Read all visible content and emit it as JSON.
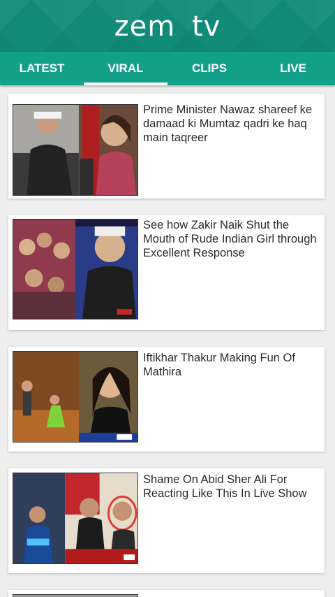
{
  "app": {
    "logo_text": "zem tv"
  },
  "tabs": [
    {
      "label": "LATEST",
      "active": false
    },
    {
      "label": "VIRAL",
      "active": true
    },
    {
      "label": "CLIPS",
      "active": false
    },
    {
      "label": "LIVE",
      "active": false
    }
  ],
  "feed": {
    "items": [
      {
        "title": "Prime Minister Nawaz shareef ke damaad ki Mumtaz qadri ke haq main taqreer"
      },
      {
        "title": "See how Zakir Naik Shut the Mouth of Rude Indian Girl through Excellent Response"
      },
      {
        "title": "Iftikhar Thakur Making Fun Of Mathira"
      },
      {
        "title": "Shame On Abid Sher Ali For Reacting Like This In Live Show"
      },
      {
        "title": ""
      }
    ]
  },
  "colors": {
    "header": "#0f8b78",
    "tabs": "#13a089",
    "indicator": "#ffffff",
    "background": "#eeeeee"
  }
}
